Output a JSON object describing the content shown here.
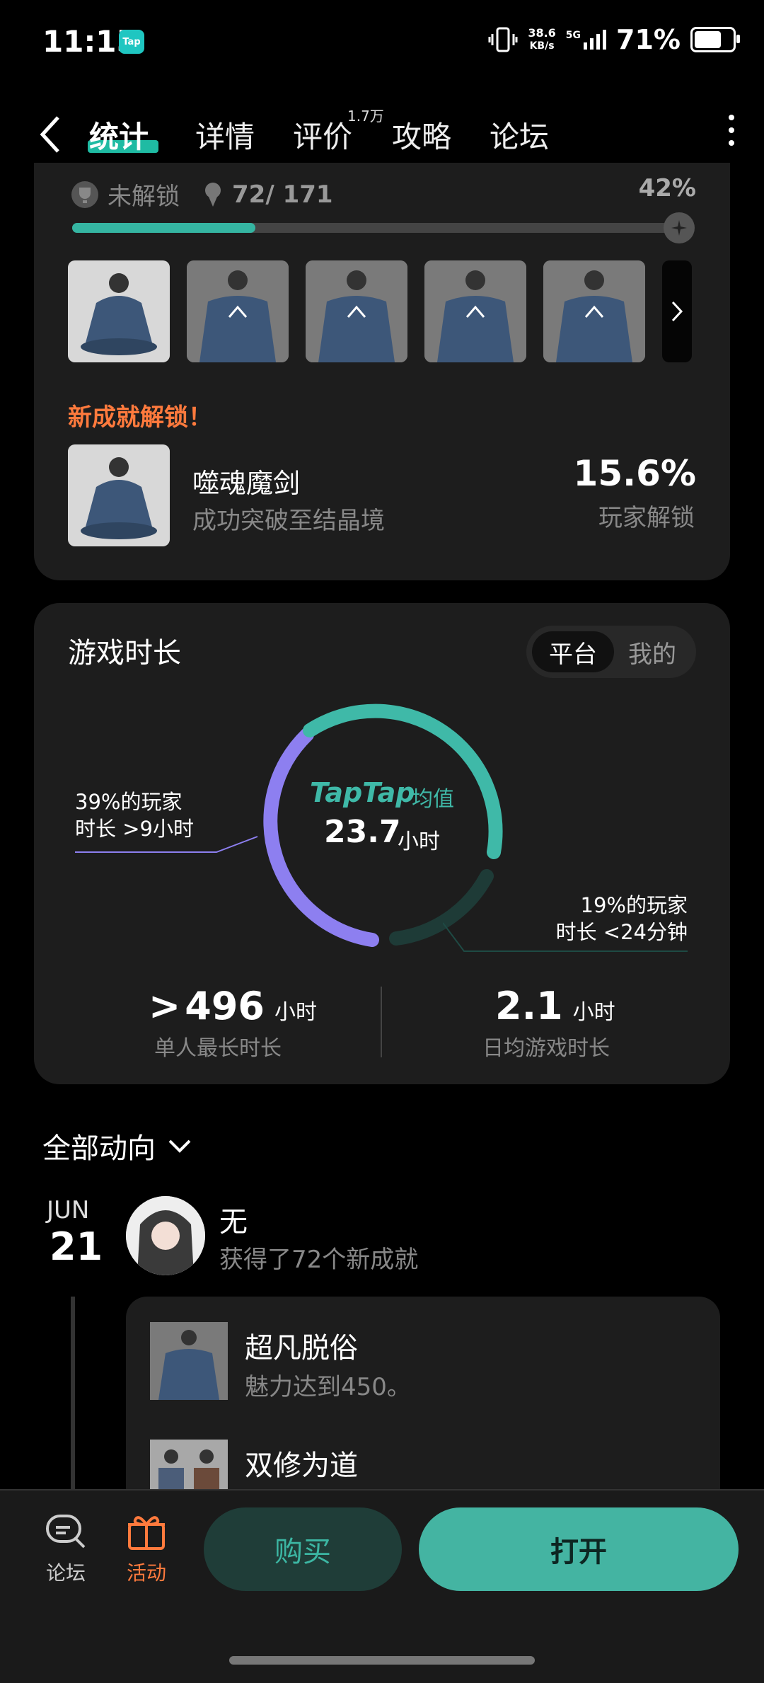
{
  "status": {
    "time": "11:15",
    "app_badge": "Tap",
    "net_speed_value": "38.6",
    "net_speed_unit": "KB/s",
    "network": "5G",
    "battery": "71%",
    "battery_level": 0.71
  },
  "nav": {
    "tabs": [
      "统计",
      "详情",
      "评价",
      "攻略",
      "论坛"
    ],
    "active_tab": "统计",
    "review_count": "1.7万"
  },
  "achievements": {
    "locked_label": "未解锁",
    "progress_text": "72/ 171",
    "percent": "42%",
    "progress_fraction": 0.42,
    "new_unlock_label": "新成就解锁！",
    "new_title": "噬魂魔剑",
    "new_desc": "成功突破至结晶境",
    "new_rate": "15.6%",
    "new_rate_label": "玩家解锁"
  },
  "playtime": {
    "title": "游戏时长",
    "toggle_on": "平台",
    "toggle_off": "我的",
    "brand": "TapTap",
    "avg_label": "均值",
    "avg_value": "23.7",
    "avg_unit": "小时",
    "note_left_1": "39%的玩家",
    "note_left_2": "时长 >9小时",
    "note_right_1": "19%的玩家",
    "note_right_2": "时长 <24分钟",
    "longest_value": "496",
    "longest_unit": "小时",
    "longest_label": "单人最长时长",
    "daily_value": "2.1",
    "daily_unit": "小时",
    "daily_label": "日均游戏时长",
    "accent": "#3fb9a8",
    "purple": "#8d7ff0"
  },
  "feed": {
    "header": "全部动向",
    "month": "JUN",
    "day": "21",
    "user": "无",
    "action": "获得了72个新成就",
    "items": [
      {
        "title": "超凡脱俗",
        "desc": "魅力达到450。"
      },
      {
        "title": "双修为道",
        "desc": ""
      }
    ]
  },
  "bottom": {
    "forum": "论坛",
    "activity": "活动",
    "buy": "购买",
    "open": "打开",
    "accent_orange": "#ff7a3d"
  }
}
